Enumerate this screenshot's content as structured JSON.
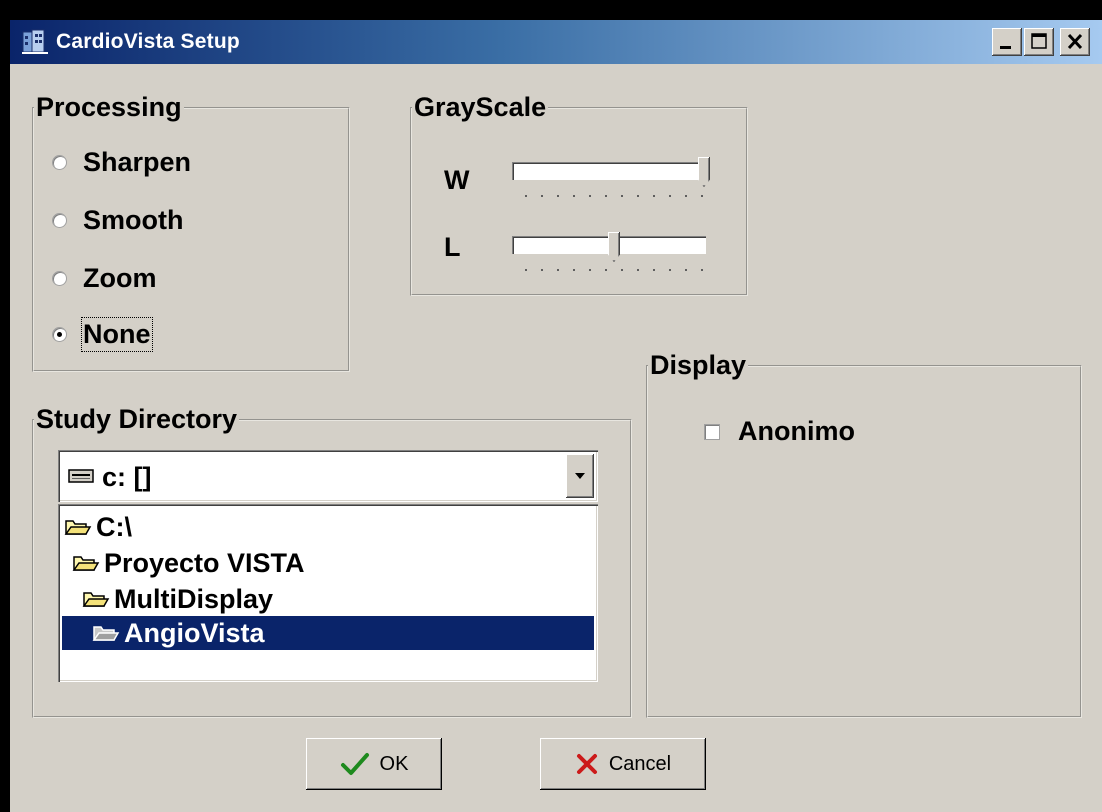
{
  "window": {
    "title": "CardioVista Setup",
    "icon": "cardiovista-app-icon",
    "controls": {
      "minimize": "minimize-icon",
      "maximize": "maximize-icon",
      "close": "close-icon"
    }
  },
  "processing": {
    "legend": "Processing",
    "options": [
      {
        "label": "Sharpen",
        "checked": false
      },
      {
        "label": "Smooth",
        "checked": false
      },
      {
        "label": "Zoom",
        "checked": false
      },
      {
        "label": "None",
        "checked": true
      }
    ]
  },
  "grayscale": {
    "legend": "GrayScale",
    "sliders": [
      {
        "label": "W",
        "level": 1.0
      },
      {
        "label": "L",
        "level": 0.5
      }
    ]
  },
  "study_directory": {
    "legend": "Study Directory",
    "drive": {
      "label": "c: []",
      "icon": "drive-icon"
    },
    "folders": [
      {
        "name": "C:\\",
        "selected": false
      },
      {
        "name": "Proyecto VISTA",
        "selected": false
      },
      {
        "name": "MultiDisplay",
        "selected": false
      },
      {
        "name": "AngioVista",
        "selected": true
      }
    ]
  },
  "display": {
    "legend": "Display",
    "checkbox": {
      "label": "Anonimo",
      "checked": false
    }
  },
  "buttons": {
    "ok": "OK",
    "cancel": "Cancel"
  },
  "colors": {
    "face": "#d4d0c8",
    "title_start": "#0a246a",
    "title_end": "#a6caf0",
    "selection": "#0a246a",
    "ok_check": "#1e8a1e",
    "cancel_x": "#cc1a1a"
  }
}
